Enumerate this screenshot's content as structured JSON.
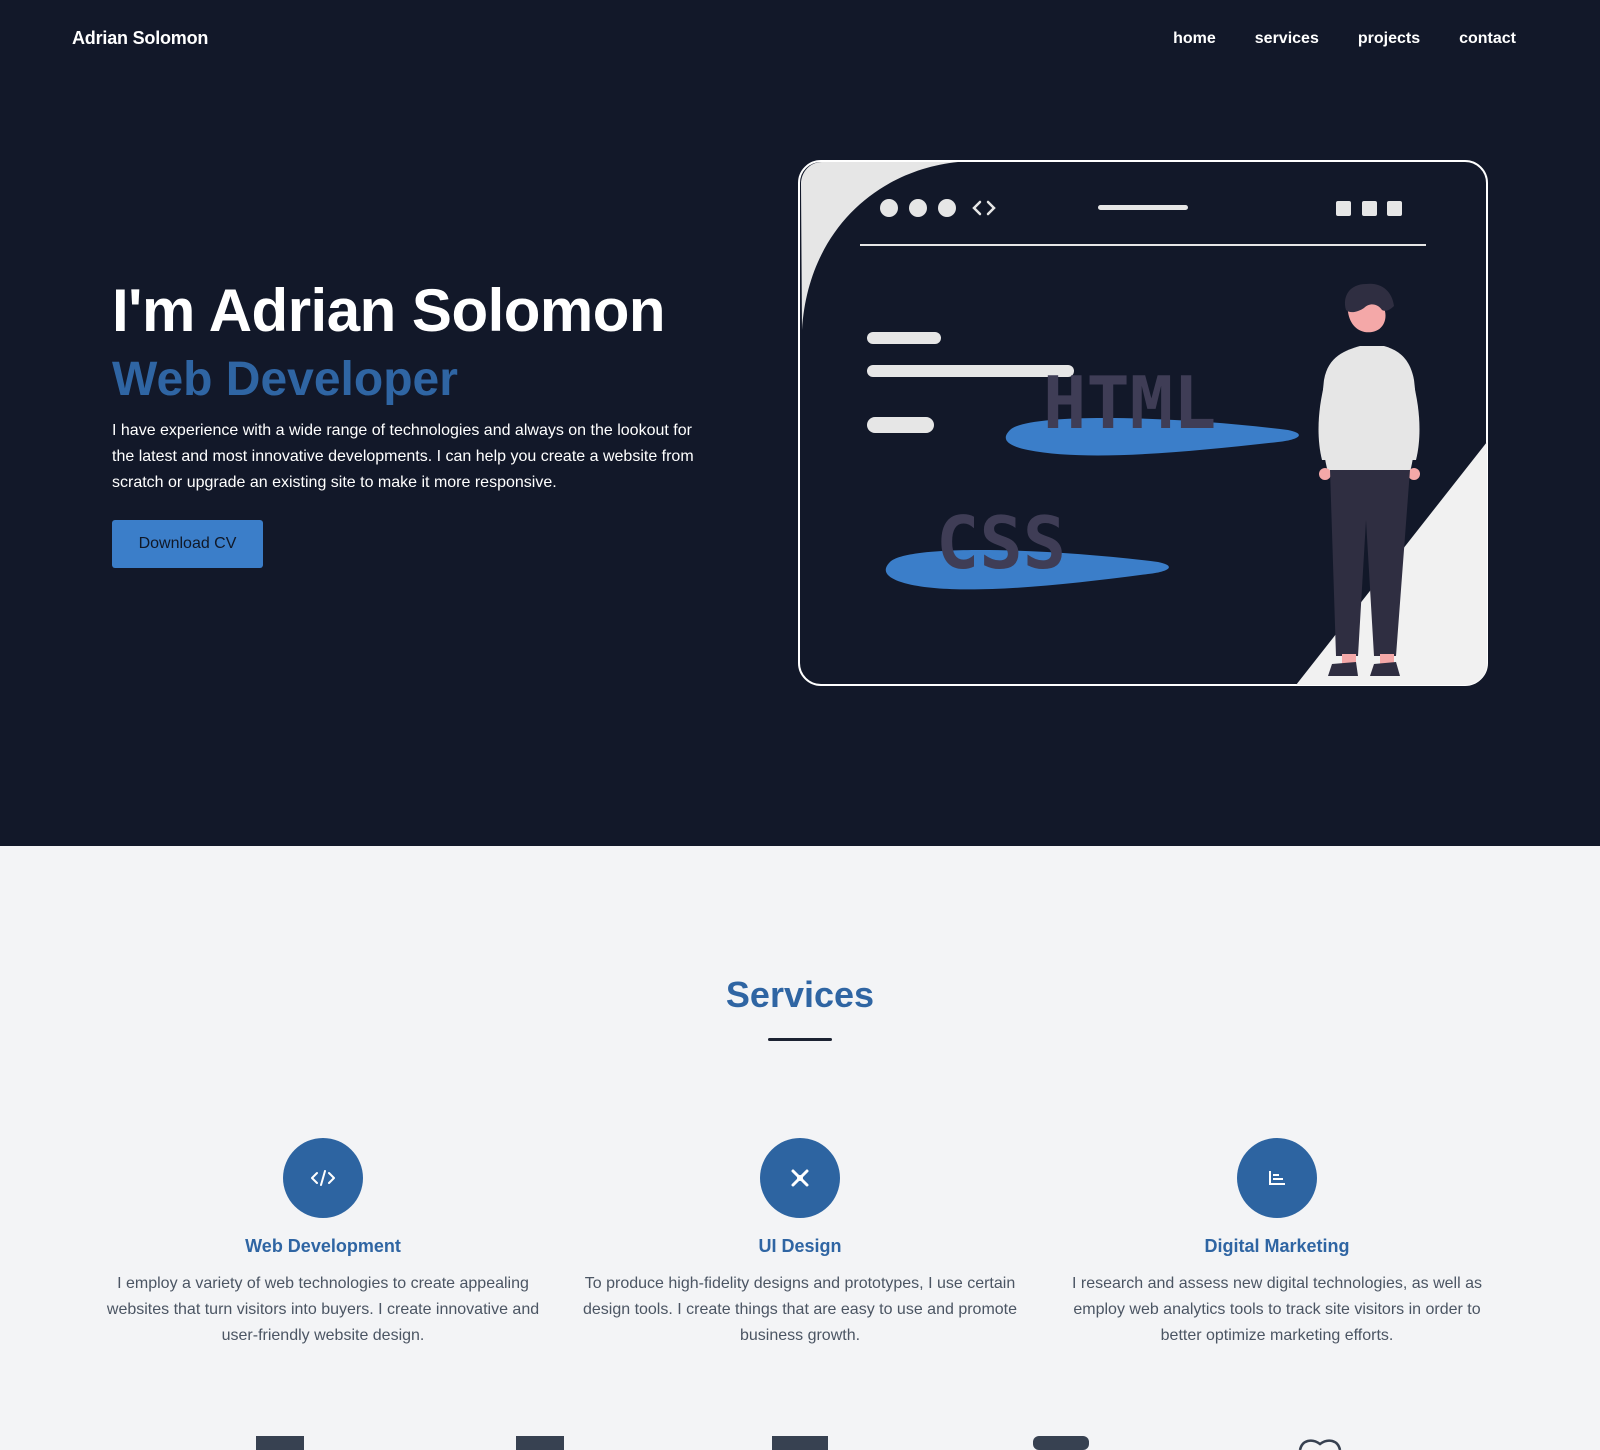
{
  "header": {
    "brand": "Adrian Solomon",
    "nav": [
      "home",
      "services",
      "projects",
      "contact"
    ]
  },
  "hero": {
    "title": "I'm Adrian Solomon",
    "subtitle": "Web Developer",
    "text": "I have experience with a wide range of technologies and always on the lookout for the latest and most innovative developments. I can help you create a website from scratch or upgrade an existing site to make it more responsive.",
    "cta_label": "Download CV",
    "illustration": {
      "words": [
        "HTML",
        "CSS"
      ]
    }
  },
  "services": {
    "title": "Services",
    "items": [
      {
        "icon": "code-icon",
        "title": "Web Development",
        "text": "I employ a variety of web technologies to create appealing websites that turn visitors into buyers. I create innovative and user-friendly website design."
      },
      {
        "icon": "design-tools-icon",
        "title": "UI Design",
        "text": "To produce high-fidelity designs and prototypes, I use certain design tools. I create things that are easy to use and promote business growth."
      },
      {
        "icon": "chart-icon",
        "title": "Digital Marketing",
        "text": "I research and assess new digital technologies, as well as employ web analytics tools to track site visitors in order to better optimize marketing efforts."
      }
    ]
  },
  "colors": {
    "hero_bg": "#121829",
    "accent": "#2f65a3",
    "button": "#3b7ec9",
    "page_bg": "#f3f4f6"
  }
}
